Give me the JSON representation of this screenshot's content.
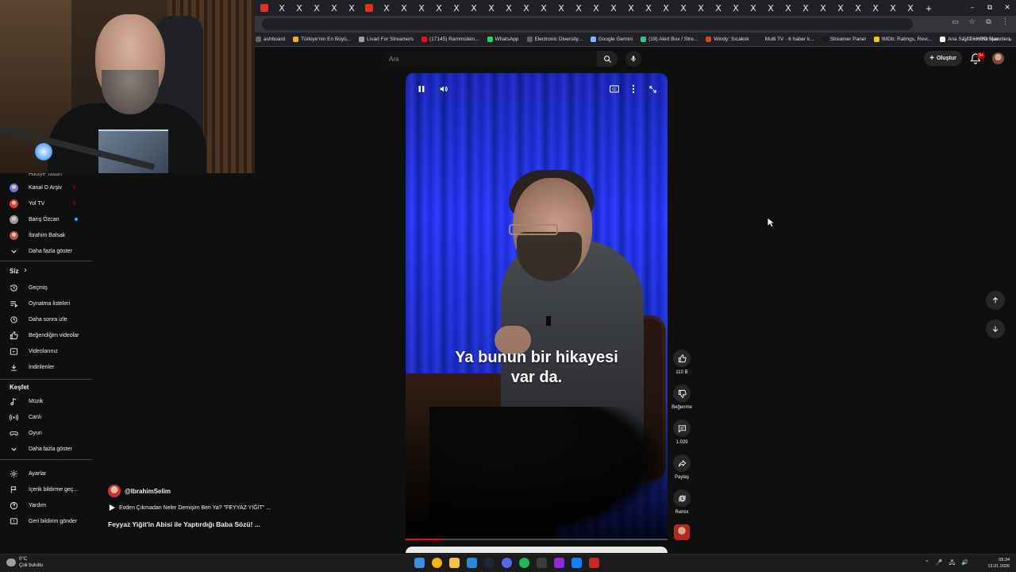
{
  "browser": {
    "tab_close_glyph": "X",
    "tab_count": 38,
    "new_tab": "+",
    "window_controls": [
      "–",
      "⧉",
      "✕"
    ],
    "bookmarks": [
      {
        "label": "ashboard",
        "color": "#5f6368"
      },
      {
        "label": "Türkiye'nin En Büyü...",
        "color": "#f2b705"
      },
      {
        "label": "Livad For Streamers",
        "color": "#9aa0a6"
      },
      {
        "label": "(17145) Rammstein...",
        "color": "#ff0033"
      },
      {
        "label": "WhatsApp",
        "color": "#25d366"
      },
      {
        "label": "Electronic Diversity...",
        "color": "#5f6368"
      },
      {
        "label": "Google Gemini",
        "color": "#8ab4f8"
      },
      {
        "label": "(19) Alert Box / Stre...",
        "color": "#31c48d"
      },
      {
        "label": "Windy: Sıcaklık",
        "color": "#e53935"
      },
      {
        "label": "Multi TV - 6 haber k...",
        "color": "#202124"
      },
      {
        "label": "Streamer Panel",
        "color": "#1a1a1a"
      },
      {
        "label": "IMDb: Ratings, Revi...",
        "color": "#f5c518"
      },
      {
        "label": "Ana Sayfa • HBO Max",
        "color": "#ffffff"
      }
    ],
    "bookmarks_more": "»",
    "all_bookmarks": "Tüm Yer İşaretleri"
  },
  "topbar": {
    "search_placeholder": "Ara",
    "create_label": "Oluştur",
    "notif_count": "9+"
  },
  "sidebar": {
    "partial_item": "Hikâye Tadan",
    "subscriptions": [
      {
        "label": "Kanal D Arşiv",
        "status": "live",
        "avatar_color": "#6a7ccf"
      },
      {
        "label": "Yol TV",
        "status": "live",
        "avatar_color": "#e53935"
      },
      {
        "label": "Barış Özcan",
        "status": "dot",
        "avatar_color": "#9a9a9a"
      },
      {
        "label": "İbrahim Balsak",
        "status": "",
        "avatar_color": "#b05a4a"
      }
    ],
    "live_badge": "))",
    "show_more": "Daha fazla göster",
    "you_header": "Siz",
    "you_items": [
      {
        "label": "Geçmiş",
        "icon": "history-icon"
      },
      {
        "label": "Oynatma listeleri",
        "icon": "playlist-icon"
      },
      {
        "label": "Daha sonra izle",
        "icon": "watch-later-icon"
      },
      {
        "label": "Beğendiğim videolar",
        "icon": "thumb-up-icon"
      },
      {
        "label": "Videolarınız",
        "icon": "your-videos-icon"
      },
      {
        "label": "İndirilenler",
        "icon": "download-icon"
      }
    ],
    "explore_header": "Keşfet",
    "explore_items": [
      {
        "label": "Müzik",
        "icon": "music-icon"
      },
      {
        "label": "Canlı",
        "icon": "live-icon"
      },
      {
        "label": "Oyun",
        "icon": "gaming-icon"
      }
    ],
    "explore_more": "Daha fazla göster",
    "footer_items": [
      {
        "label": "Ayarlar",
        "icon": "settings-icon"
      },
      {
        "label": "İçerik bildirme geç...",
        "icon": "flag-icon"
      },
      {
        "label": "Yardım",
        "icon": "help-icon"
      },
      {
        "label": "Geri bildirim gönder",
        "icon": "feedback-icon"
      }
    ]
  },
  "player": {
    "caption_line1": "Ya bunun bir hikayesi",
    "caption_line2": "var da.",
    "progress_fraction": 0.14
  },
  "actions": {
    "likes": "110 B",
    "dislike_label": "Beğenme",
    "comments": "1.029",
    "share_label": "Paylaş",
    "remix_label": "Remix"
  },
  "short_info": {
    "channel": "@IbrahimSelim",
    "related": "Evden Çıkmadan Neler Demişim Ben Ya? \"FEYYAZ YİĞİT\" ...",
    "title": "Feyyaz Yiğit'in Abisi ile Yaptırdığı Baba Sözü! ..."
  },
  "taskbar": {
    "temp": "0°C",
    "weather": "Çok bulutlu",
    "time": "09:34",
    "date": "13.01.2026",
    "apps": [
      {
        "name": "windows-start-icon",
        "color": "#3a8ee6"
      },
      {
        "name": "chrome-icon",
        "color": "#f4b400"
      },
      {
        "name": "file-explorer-icon",
        "color": "#f3c343"
      },
      {
        "name": "app-icon-blue",
        "color": "#2b88d8"
      },
      {
        "name": "steam-icon",
        "color": "#1b2838"
      },
      {
        "name": "discord-icon",
        "color": "#5865f2"
      },
      {
        "name": "spotify-icon",
        "color": "#1db954"
      },
      {
        "name": "calculator-icon",
        "color": "#3c3c3c"
      },
      {
        "name": "app-icon-purple",
        "color": "#8a2be2"
      },
      {
        "name": "app-icon-azure",
        "color": "#0a84ff"
      },
      {
        "name": "app-icon-red",
        "color": "#c62828"
      }
    ],
    "tray": [
      "⌃",
      "🎤",
      "🖧",
      "🔊"
    ]
  }
}
